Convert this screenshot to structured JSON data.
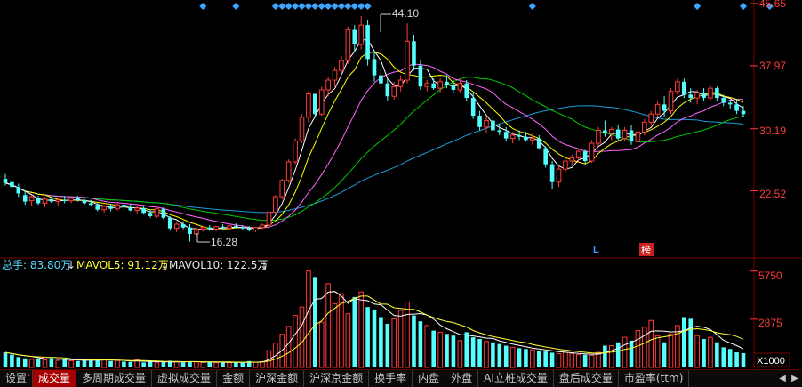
{
  "chart_data": [
    {
      "type": "candlestick",
      "title": "",
      "price_ticks": [
        "45.65",
        "37.97",
        "30.19",
        "22.52"
      ],
      "ylim": [
        15.0,
        45.65
      ],
      "high_label": "44.10",
      "low_label": "16.28",
      "markers": [
        "L",
        "榜"
      ],
      "ma_colors": {
        "ma5": "#ffffff",
        "ma10": "#ffff00",
        "ma20": "#ff66ff",
        "ma30": "#00cc00",
        "ma60": "#1e9bd7"
      },
      "candles": [
        {
          "o": 24.0,
          "h": 24.6,
          "l": 23.2,
          "c": 23.5
        },
        {
          "o": 23.6,
          "h": 24.0,
          "l": 22.8,
          "c": 23.0
        },
        {
          "o": 23.0,
          "h": 23.4,
          "l": 21.8,
          "c": 22.2
        },
        {
          "o": 22.0,
          "h": 22.6,
          "l": 20.8,
          "c": 21.2
        },
        {
          "o": 21.3,
          "h": 22.0,
          "l": 20.6,
          "c": 21.8
        },
        {
          "o": 21.6,
          "h": 21.9,
          "l": 20.8,
          "c": 21.0
        },
        {
          "o": 21.0,
          "h": 21.8,
          "l": 20.5,
          "c": 21.5
        },
        {
          "o": 21.5,
          "h": 21.8,
          "l": 21.0,
          "c": 21.2
        },
        {
          "o": 21.2,
          "h": 21.6,
          "l": 20.6,
          "c": 21.4
        },
        {
          "o": 21.4,
          "h": 21.9,
          "l": 21.0,
          "c": 21.3
        },
        {
          "o": 21.3,
          "h": 21.7,
          "l": 21.0,
          "c": 21.6
        },
        {
          "o": 21.6,
          "h": 21.9,
          "l": 21.2,
          "c": 21.4
        },
        {
          "o": 21.4,
          "h": 21.6,
          "l": 20.8,
          "c": 21.0
        },
        {
          "o": 21.0,
          "h": 21.4,
          "l": 20.6,
          "c": 20.8
        },
        {
          "o": 20.8,
          "h": 21.0,
          "l": 20.0,
          "c": 20.2
        },
        {
          "o": 20.2,
          "h": 20.8,
          "l": 19.8,
          "c": 20.6
        },
        {
          "o": 20.6,
          "h": 20.9,
          "l": 20.0,
          "c": 20.3
        },
        {
          "o": 20.3,
          "h": 21.0,
          "l": 20.1,
          "c": 20.8
        },
        {
          "o": 20.8,
          "h": 21.0,
          "l": 20.2,
          "c": 20.5
        },
        {
          "o": 20.5,
          "h": 20.9,
          "l": 20.0,
          "c": 20.1
        },
        {
          "o": 20.1,
          "h": 20.6,
          "l": 19.7,
          "c": 20.4
        },
        {
          "o": 20.4,
          "h": 20.7,
          "l": 19.6,
          "c": 19.8
        },
        {
          "o": 19.8,
          "h": 20.2,
          "l": 19.2,
          "c": 19.4
        },
        {
          "o": 19.4,
          "h": 20.6,
          "l": 19.2,
          "c": 20.3
        },
        {
          "o": 20.3,
          "h": 20.5,
          "l": 19.0,
          "c": 19.2
        },
        {
          "o": 19.2,
          "h": 19.4,
          "l": 17.6,
          "c": 17.9
        },
        {
          "o": 17.9,
          "h": 18.6,
          "l": 17.4,
          "c": 18.4
        },
        {
          "o": 18.4,
          "h": 18.8,
          "l": 17.8,
          "c": 18.0
        },
        {
          "o": 18.0,
          "h": 18.4,
          "l": 16.28,
          "c": 17.2
        },
        {
          "o": 17.2,
          "h": 18.0,
          "l": 17.0,
          "c": 17.8
        },
        {
          "o": 17.8,
          "h": 18.2,
          "l": 17.5,
          "c": 18.0
        },
        {
          "o": 18.0,
          "h": 18.3,
          "l": 17.6,
          "c": 17.8
        },
        {
          "o": 17.8,
          "h": 18.2,
          "l": 17.5,
          "c": 18.1
        },
        {
          "o": 18.1,
          "h": 18.4,
          "l": 17.7,
          "c": 17.9
        },
        {
          "o": 17.9,
          "h": 18.3,
          "l": 17.6,
          "c": 18.2
        },
        {
          "o": 18.2,
          "h": 18.5,
          "l": 17.9,
          "c": 18.0
        },
        {
          "o": 18.0,
          "h": 18.3,
          "l": 17.7,
          "c": 17.9
        },
        {
          "o": 17.9,
          "h": 18.2,
          "l": 17.5,
          "c": 17.7
        },
        {
          "o": 17.7,
          "h": 18.1,
          "l": 17.4,
          "c": 18.0
        },
        {
          "o": 18.0,
          "h": 18.5,
          "l": 17.8,
          "c": 18.3
        },
        {
          "o": 18.3,
          "h": 20.1,
          "l": 18.0,
          "c": 19.9
        },
        {
          "o": 19.9,
          "h": 22.0,
          "l": 19.6,
          "c": 21.8
        },
        {
          "o": 21.8,
          "h": 24.0,
          "l": 21.5,
          "c": 23.8
        },
        {
          "o": 23.8,
          "h": 26.4,
          "l": 23.5,
          "c": 26.1
        },
        {
          "o": 26.1,
          "h": 29.0,
          "l": 25.8,
          "c": 28.7
        },
        {
          "o": 28.7,
          "h": 32.0,
          "l": 28.4,
          "c": 31.6
        },
        {
          "o": 31.6,
          "h": 34.8,
          "l": 31.0,
          "c": 34.5
        },
        {
          "o": 34.5,
          "h": 33.8,
          "l": 31.6,
          "c": 32.0
        },
        {
          "o": 32.0,
          "h": 35.4,
          "l": 31.8,
          "c": 35.0
        },
        {
          "o": 35.0,
          "h": 36.6,
          "l": 34.2,
          "c": 36.2
        },
        {
          "o": 36.2,
          "h": 37.8,
          "l": 35.4,
          "c": 37.4
        },
        {
          "o": 37.4,
          "h": 39.2,
          "l": 36.8,
          "c": 38.6
        },
        {
          "o": 38.6,
          "h": 42.8,
          "l": 38.2,
          "c": 42.4
        },
        {
          "o": 42.4,
          "h": 43.0,
          "l": 39.6,
          "c": 40.6
        },
        {
          "o": 40.6,
          "h": 44.1,
          "l": 40.0,
          "c": 43.0
        },
        {
          "o": 43.0,
          "h": 43.6,
          "l": 38.0,
          "c": 38.8
        },
        {
          "o": 38.8,
          "h": 39.8,
          "l": 36.0,
          "c": 36.8
        },
        {
          "o": 36.8,
          "h": 37.6,
          "l": 35.2,
          "c": 35.8
        },
        {
          "o": 35.8,
          "h": 36.4,
          "l": 33.6,
          "c": 34.2
        },
        {
          "o": 34.2,
          "h": 36.0,
          "l": 33.8,
          "c": 35.4
        },
        {
          "o": 35.4,
          "h": 36.8,
          "l": 34.8,
          "c": 36.2
        },
        {
          "o": 36.2,
          "h": 43.2,
          "l": 35.8,
          "c": 41.0
        },
        {
          "o": 41.0,
          "h": 41.8,
          "l": 37.4,
          "c": 38.0
        },
        {
          "o": 38.0,
          "h": 38.6,
          "l": 35.0,
          "c": 35.4
        },
        {
          "o": 35.4,
          "h": 36.2,
          "l": 34.8,
          "c": 35.8
        },
        {
          "o": 35.8,
          "h": 36.4,
          "l": 35.0,
          "c": 35.2
        },
        {
          "o": 35.2,
          "h": 36.4,
          "l": 34.6,
          "c": 36.0
        },
        {
          "o": 36.0,
          "h": 36.8,
          "l": 35.2,
          "c": 35.6
        },
        {
          "o": 35.6,
          "h": 36.2,
          "l": 34.6,
          "c": 35.0
        },
        {
          "o": 35.0,
          "h": 36.4,
          "l": 34.6,
          "c": 35.8
        },
        {
          "o": 35.8,
          "h": 36.2,
          "l": 33.6,
          "c": 34.0
        },
        {
          "o": 34.0,
          "h": 34.6,
          "l": 31.4,
          "c": 31.8
        },
        {
          "o": 31.8,
          "h": 32.4,
          "l": 30.0,
          "c": 30.4
        },
        {
          "o": 30.4,
          "h": 31.6,
          "l": 29.6,
          "c": 31.2
        },
        {
          "o": 31.2,
          "h": 31.8,
          "l": 29.8,
          "c": 30.0
        },
        {
          "o": 30.0,
          "h": 30.8,
          "l": 29.4,
          "c": 29.8
        },
        {
          "o": 29.8,
          "h": 30.4,
          "l": 28.6,
          "c": 29.0
        },
        {
          "o": 29.0,
          "h": 29.8,
          "l": 28.4,
          "c": 29.4
        },
        {
          "o": 29.4,
          "h": 30.0,
          "l": 28.8,
          "c": 29.2
        },
        {
          "o": 29.2,
          "h": 29.8,
          "l": 28.6,
          "c": 28.8
        },
        {
          "o": 28.8,
          "h": 29.6,
          "l": 28.2,
          "c": 29.0
        },
        {
          "o": 29.0,
          "h": 29.4,
          "l": 27.6,
          "c": 27.8
        },
        {
          "o": 27.8,
          "h": 28.0,
          "l": 25.4,
          "c": 25.8
        },
        {
          "o": 25.8,
          "h": 26.2,
          "l": 22.8,
          "c": 23.6
        },
        {
          "o": 23.6,
          "h": 25.6,
          "l": 23.0,
          "c": 25.2
        },
        {
          "o": 25.2,
          "h": 26.6,
          "l": 24.8,
          "c": 26.2
        },
        {
          "o": 26.2,
          "h": 27.0,
          "l": 25.6,
          "c": 26.6
        },
        {
          "o": 26.6,
          "h": 27.8,
          "l": 26.0,
          "c": 27.4
        },
        {
          "o": 27.4,
          "h": 27.6,
          "l": 25.8,
          "c": 26.2
        },
        {
          "o": 26.2,
          "h": 28.8,
          "l": 26.0,
          "c": 28.4
        },
        {
          "o": 28.4,
          "h": 30.4,
          "l": 28.0,
          "c": 30.0
        },
        {
          "o": 30.0,
          "h": 31.2,
          "l": 29.2,
          "c": 29.6
        },
        {
          "o": 29.6,
          "h": 30.4,
          "l": 28.8,
          "c": 30.1
        },
        {
          "o": 30.1,
          "h": 30.6,
          "l": 28.6,
          "c": 29.0
        },
        {
          "o": 29.0,
          "h": 30.4,
          "l": 28.6,
          "c": 30.0
        },
        {
          "o": 30.0,
          "h": 30.6,
          "l": 28.2,
          "c": 28.6
        },
        {
          "o": 28.6,
          "h": 30.2,
          "l": 28.4,
          "c": 29.8
        },
        {
          "o": 29.8,
          "h": 31.4,
          "l": 29.4,
          "c": 31.0
        },
        {
          "o": 31.0,
          "h": 32.4,
          "l": 30.6,
          "c": 32.0
        },
        {
          "o": 32.0,
          "h": 33.6,
          "l": 31.6,
          "c": 33.2
        },
        {
          "o": 33.2,
          "h": 34.2,
          "l": 31.6,
          "c": 32.4
        },
        {
          "o": 32.4,
          "h": 35.2,
          "l": 32.0,
          "c": 34.8
        },
        {
          "o": 34.8,
          "h": 36.4,
          "l": 34.4,
          "c": 36.0
        },
        {
          "o": 36.0,
          "h": 36.4,
          "l": 34.0,
          "c": 34.4
        },
        {
          "o": 34.4,
          "h": 35.2,
          "l": 33.4,
          "c": 34.0
        },
        {
          "o": 34.0,
          "h": 35.0,
          "l": 33.2,
          "c": 34.6
        },
        {
          "o": 34.6,
          "h": 35.2,
          "l": 33.6,
          "c": 34.0
        },
        {
          "o": 34.0,
          "h": 35.6,
          "l": 33.6,
          "c": 35.2
        },
        {
          "o": 35.2,
          "h": 35.4,
          "l": 33.6,
          "c": 34.0
        },
        {
          "o": 34.0,
          "h": 34.4,
          "l": 33.0,
          "c": 33.4
        },
        {
          "o": 33.4,
          "h": 33.8,
          "l": 32.6,
          "c": 33.2
        },
        {
          "o": 33.2,
          "h": 33.8,
          "l": 32.0,
          "c": 32.4
        },
        {
          "o": 32.4,
          "h": 33.0,
          "l": 31.6,
          "c": 32.0
        }
      ]
    },
    {
      "type": "bar",
      "title": "",
      "legend": {
        "total_label": "总手: 83.80万",
        "mavol5_label": "MAVOL5: 91.12万",
        "mavol10_label": "MAVOL10: 122.5万"
      },
      "ticks": [
        "5750",
        "2875"
      ],
      "unit_label": "X1000",
      "ylim": [
        0,
        6000
      ],
      "volumes": [
        900,
        760,
        620,
        540,
        480,
        520,
        450,
        560,
        420,
        480,
        400,
        380,
        470,
        410,
        520,
        460,
        380,
        420,
        350,
        330,
        450,
        300,
        360,
        280,
        320,
        400,
        350,
        310,
        370,
        330,
        300,
        340,
        280,
        310,
        290,
        330,
        270,
        380,
        320,
        350,
        1000,
        1450,
        1980,
        2450,
        3100,
        3600,
        5750,
        5400,
        2700,
        5000,
        3800,
        4400,
        3200,
        4200,
        4500,
        3600,
        3400,
        3000,
        2600,
        2900,
        3400,
        3900,
        3100,
        2750,
        2500,
        2200,
        2100,
        2000,
        1900,
        1600,
        2100,
        1800,
        1700,
        1550,
        1500,
        1400,
        1300,
        1200,
        1150,
        1100,
        1050,
        1000,
        950,
        880,
        820,
        900,
        820,
        760,
        760,
        720,
        900,
        1300,
        1300,
        1500,
        1800,
        1600,
        2200,
        2400,
        2800,
        1900,
        1500,
        2000,
        2500,
        3000,
        2900,
        1900,
        1700,
        1800,
        1500,
        1200,
        1100,
        900,
        850
      ]
    }
  ],
  "tabs": [
    "设置",
    "成交量",
    "多周期成交量",
    "虚拟成交量",
    "金额",
    "沪深金额",
    "沪深京金额",
    "换手率",
    "内盘",
    "外盘",
    "AI立桩成交量",
    "盘后成交量",
    "市盈率(ttm)"
  ],
  "active_tab": "成交量",
  "tab_dot": "•"
}
